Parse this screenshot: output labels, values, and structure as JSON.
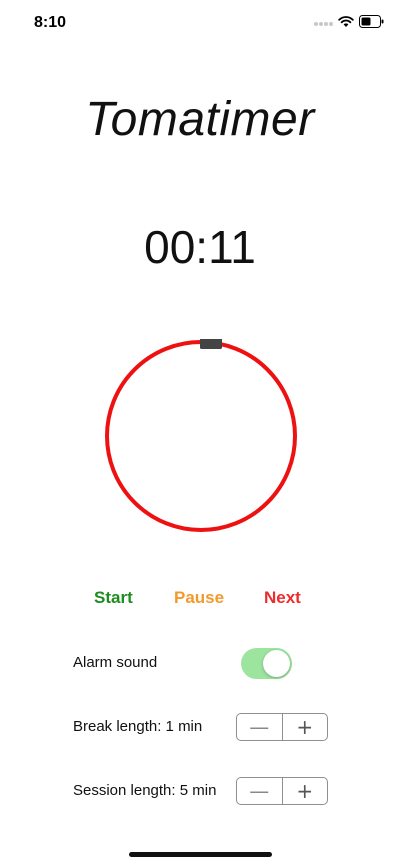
{
  "status_bar": {
    "time": "8:10",
    "icons": [
      "signal-icon",
      "wifi-icon",
      "battery-icon"
    ]
  },
  "app": {
    "title": "Tomatimer",
    "timer_display": "00:11"
  },
  "dial": {
    "ring_color": "#ee1111",
    "handle_color": "#444444",
    "progress_fraction": 0.0
  },
  "controls": {
    "start_label": "Start",
    "pause_label": "Pause",
    "next_label": "Next",
    "start_color": "#1e8c1e",
    "pause_color": "#f39a2c",
    "next_color": "#ee2c2c"
  },
  "settings": {
    "alarm_label": "Alarm sound",
    "alarm_on": true,
    "break_label": "Break length: 1 min",
    "session_label": "Session length: 5 min",
    "minus_symbol": "—",
    "plus_symbol": "+"
  }
}
